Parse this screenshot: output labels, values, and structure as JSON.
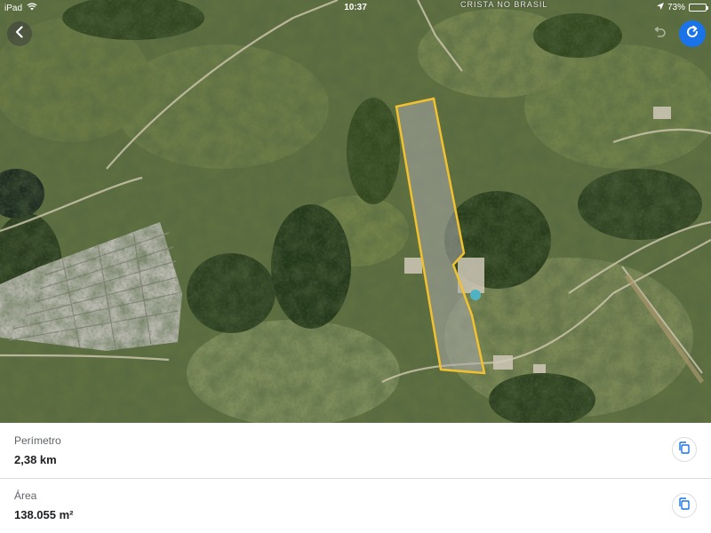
{
  "status_bar": {
    "device": "iPad",
    "time": "10:37",
    "battery": "73%",
    "battery_level": 0.73
  },
  "map": {
    "place_label": "CRISTA NO BRASIL",
    "polygon_color": "#f2c12e"
  },
  "controls": {
    "back_icon": "chevron-left-icon",
    "undo_icon": "undo-icon",
    "refresh_icon": "refresh-icon",
    "accent": "#1a73e8"
  },
  "measurements": {
    "perimeter": {
      "label": "Perímetro",
      "value": "2,38 km"
    },
    "area": {
      "label": "Área",
      "value": "138.055 m²"
    },
    "copy_icon": "copy-icon"
  }
}
